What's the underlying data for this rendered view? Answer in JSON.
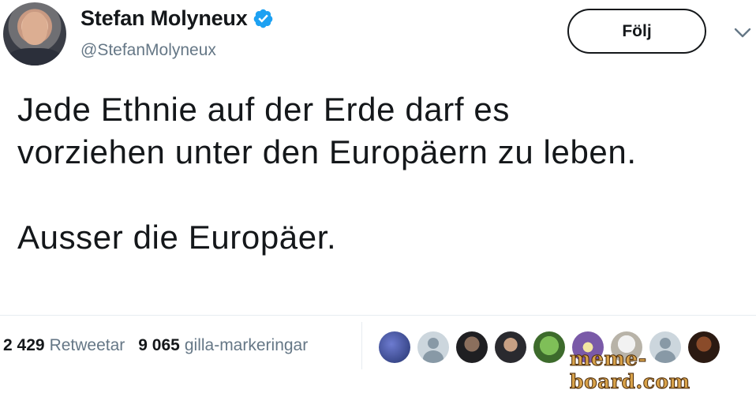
{
  "author": {
    "name": "Stefan Molyneux",
    "handle": "@StefanMolyneux",
    "verified": true,
    "avatar_icon": "profile-photo"
  },
  "actions": {
    "follow_label": "Följ",
    "menu_icon": "chevron-down-icon"
  },
  "tweet": {
    "paragraph1": "Jede Ethnie auf der Erde darf es vorziehen unter den Europäern zu leben.",
    "paragraph2": "Ausser die Europäer."
  },
  "stats": {
    "retweets_count": "2 429",
    "retweets_label": "Retweetar",
    "likes_count": "9 065",
    "likes_label": "gilla-markeringar"
  },
  "likers": [
    {
      "icon": "user-avatar"
    },
    {
      "icon": "default-avatar"
    },
    {
      "icon": "user-avatar"
    },
    {
      "icon": "user-avatar"
    },
    {
      "icon": "user-avatar"
    },
    {
      "icon": "user-avatar"
    },
    {
      "icon": "user-avatar"
    },
    {
      "icon": "default-avatar"
    },
    {
      "icon": "user-avatar"
    }
  ],
  "watermark": "meme-board.com",
  "colors": {
    "text": "#14171a",
    "secondary": "#657786",
    "verified_blue": "#1da1f2",
    "border": "#e6ecf0"
  }
}
